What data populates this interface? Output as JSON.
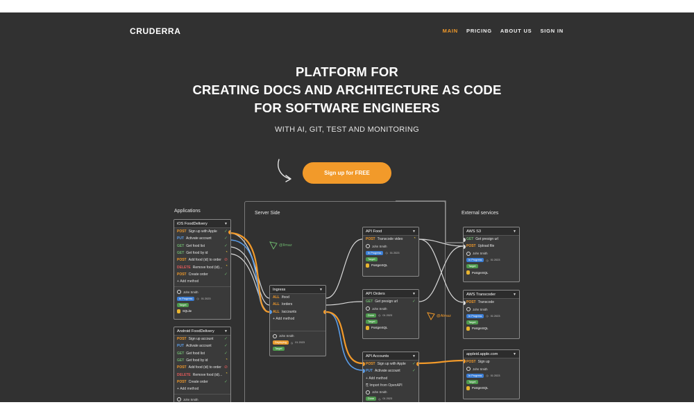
{
  "brand": "CRUDERRA",
  "nav": [
    "MAIN",
    "PRICING",
    "ABOUT US",
    "SIGN IN"
  ],
  "hero": {
    "title_lines": [
      "PLATFORM FOR",
      "CREATING DOCS AND ARCHITECTURE AS CODE",
      "FOR SOFTWARE ENGINEERS"
    ],
    "subtitle": "WITH AI, GIT, TEST AND MONITORING",
    "cta": "Sign up for FREE"
  },
  "diagram": {
    "labels": {
      "applications": "Applications",
      "server_side": "Server Side",
      "external": "External services"
    },
    "markers": {
      "green": "@Ilmaz",
      "orange": "@Almaz"
    },
    "ios": {
      "title": "iOS FoodDelivery",
      "rows": [
        {
          "method": "POST",
          "path": "Sign up with Apple",
          "status": "ok"
        },
        {
          "method": "PUT",
          "path": "Activate account",
          "status": "ok"
        },
        {
          "method": "GET",
          "path": "Get food list",
          "status": "ok"
        },
        {
          "method": "GET",
          "path": "Get food by id",
          "status": "warn"
        },
        {
          "method": "POST",
          "path": "Add food (id) to order",
          "status": "err"
        },
        {
          "method": "DELETE",
          "path": "Remove food (id)...",
          "status": "warn"
        },
        {
          "method": "POST",
          "path": "Create order",
          "status": "ok"
        }
      ],
      "add": "Add method",
      "owner": "John Smith",
      "state": "In Progress",
      "date": "01 2023",
      "target": "Target",
      "db": "SQLite"
    },
    "android": {
      "title": "Android FoodDelivery",
      "rows": [
        {
          "method": "POST",
          "path": "Sign up account",
          "status": "ok"
        },
        {
          "method": "PUT",
          "path": "Activate account",
          "status": "ok"
        },
        {
          "method": "GET",
          "path": "Get food list",
          "status": "ok"
        },
        {
          "method": "GET",
          "path": "Get food by id",
          "status": "warn"
        },
        {
          "method": "POST",
          "path": "Add food (id) to order",
          "status": "err"
        },
        {
          "method": "DELETE",
          "path": "Remove food (id)...",
          "status": "warn"
        },
        {
          "method": "POST",
          "path": "Create order",
          "status": "ok"
        }
      ],
      "add": "Add method",
      "owner": "John Smith"
    },
    "ingress": {
      "title": "Ingress",
      "rows": [
        {
          "method": "ALL",
          "path": "/food"
        },
        {
          "method": "ALL",
          "path": "/orders"
        },
        {
          "method": "ALL",
          "path": "/accounts"
        }
      ],
      "add": "Add method",
      "owner": "John Smith",
      "state": "Deploying",
      "date": "01 2023",
      "target": "Target"
    },
    "api_food": {
      "title": "API Food",
      "rows": [
        {
          "method": "POST",
          "path": "Transcode video",
          "status": "warn"
        }
      ],
      "owner": "John Smith",
      "state": "In Progress",
      "date": "01 2023",
      "target": "Target",
      "db": "PostgreSQL"
    },
    "api_orders": {
      "title": "API Orders",
      "rows": [
        {
          "method": "GET",
          "path": "Get presign url",
          "status": "ok"
        }
      ],
      "owner": "John Smith",
      "state": "Done",
      "date": "01 2023",
      "target": "Target",
      "db": "PostgreSQL"
    },
    "api_accounts": {
      "title": "API Accounts",
      "rows": [
        {
          "method": "POST",
          "path": "Sign up with Apple",
          "status": "ok"
        },
        {
          "method": "PUT",
          "path": "Activate account",
          "status": "ok"
        }
      ],
      "add": "Add method",
      "import": "Import from OpenAPI",
      "owner": "John Smith",
      "state": "Done",
      "date": "01 2023"
    },
    "aws_s3": {
      "title": "AWS S3",
      "rows": [
        {
          "method": "GET",
          "path": "Get presign url"
        },
        {
          "method": "POST",
          "path": "Upload file"
        }
      ],
      "owner": "John Smith",
      "state": "In Progress",
      "date": "01 2023",
      "target": "Target",
      "db": "PostgreSQL"
    },
    "aws_transcoder": {
      "title": "AWS Transcoder",
      "rows": [
        {
          "method": "POST",
          "path": "Transcode"
        }
      ],
      "owner": "John Smith",
      "state": "In Progress",
      "date": "01 2023",
      "target": "Target",
      "db": "PostgreSQL"
    },
    "apple": {
      "title": "appleid.apple.com",
      "rows": [
        {
          "method": "POST",
          "path": "Sign up"
        }
      ],
      "owner": "John Smith",
      "state": "In Progress",
      "date": "01 2023",
      "target": "Target",
      "db": "PostgreSQL"
    }
  },
  "colors": {
    "accent": "#f29a2a",
    "background": "#313131",
    "put": "#5b9de8",
    "get": "#6db46d",
    "delete": "#e25a5a"
  }
}
